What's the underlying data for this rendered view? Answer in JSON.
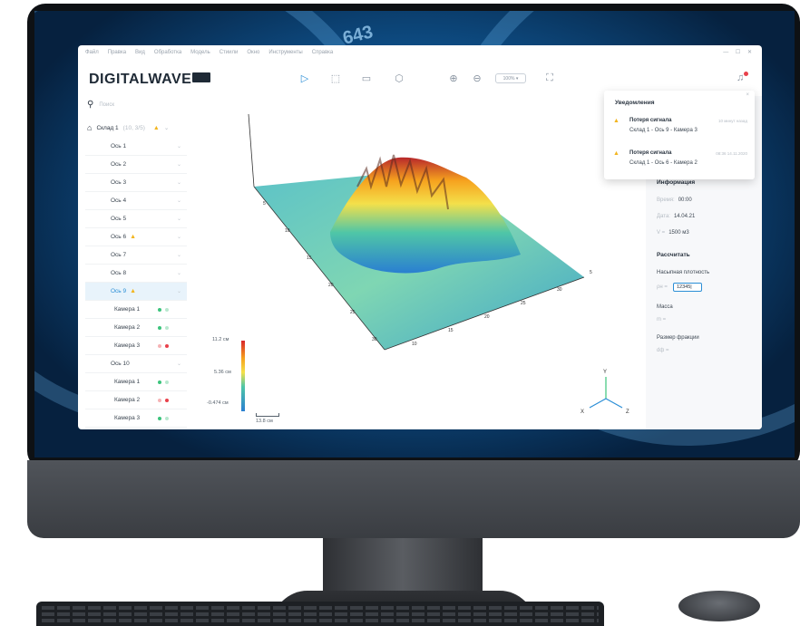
{
  "app": {
    "logo": "DIGITALWAVE",
    "menu": [
      "Файл",
      "Правка",
      "Вид",
      "Обработка",
      "Модель",
      "Стиили",
      "Окно",
      "Инструменты",
      "Справка"
    ],
    "window_controls": "— ☐ ✕",
    "zoom_value": "100% ▾"
  },
  "wall": {
    "number": "643"
  },
  "sidebar": {
    "search_placeholder": "Поиск",
    "root_label": "Склад 1",
    "root_meta": "(10, 3/5)",
    "items": [
      {
        "label": "Ось 1",
        "kind": "axis"
      },
      {
        "label": "Ось 2",
        "kind": "axis"
      },
      {
        "label": "Ось 3",
        "kind": "axis"
      },
      {
        "label": "Ось 4",
        "kind": "axis"
      },
      {
        "label": "Ось 5",
        "kind": "axis"
      },
      {
        "label": "Ось 6",
        "kind": "axis",
        "warning": true
      },
      {
        "label": "Ось 7",
        "kind": "axis"
      },
      {
        "label": "Ось 8",
        "kind": "axis"
      },
      {
        "label": "Ось 9",
        "kind": "axis",
        "warning": true,
        "active": true
      },
      {
        "label": "Камера 1",
        "kind": "cam",
        "leds": [
          "#3cc47c",
          "#b9e8cf"
        ]
      },
      {
        "label": "Камера 2",
        "kind": "cam",
        "leds": [
          "#3cc47c",
          "#b9e8cf"
        ]
      },
      {
        "label": "Камера 3",
        "kind": "cam",
        "leds": [
          "#f5b3b5",
          "#e8414b"
        ]
      },
      {
        "label": "Ось 10",
        "kind": "axis"
      },
      {
        "label": "Камера 1",
        "kind": "cam",
        "leds": [
          "#3cc47c",
          "#b9e8cf"
        ]
      },
      {
        "label": "Камера 2",
        "kind": "cam",
        "leds": [
          "#f5b3b5",
          "#e8414b"
        ]
      },
      {
        "label": "Камера 3",
        "kind": "cam",
        "leds": [
          "#3cc47c",
          "#b9e8cf"
        ]
      }
    ]
  },
  "viewport": {
    "scale_max": "11.2 см",
    "scale_mid": "5.36 см",
    "scale_min": "-0.474 см",
    "scale_ref": "13.8 см",
    "axis_x_label": "X",
    "axis_y_label": "Y",
    "axis_z_label": "Z",
    "ticks_left": [
      "5",
      "10",
      "15",
      "20",
      "25",
      "30"
    ],
    "ticks_right": [
      "10",
      "15",
      "20",
      "25",
      "30",
      "5"
    ]
  },
  "notifications": {
    "title": "Уведомления",
    "close": "×",
    "items": [
      {
        "head": "Потеря сигнала",
        "time": "10 минут назад",
        "text": "Склад 1 - Ось 9 - Камера 3"
      },
      {
        "head": "Потеря сигнала",
        "time": "08:36 14.11.2020",
        "text": "Склад 1 - Ось 6 - Камера 2"
      }
    ]
  },
  "info": {
    "title": "Информация",
    "time_label": "Время:",
    "time_value": "00:00",
    "date_label": "Дата:",
    "date_value": "14.04.21",
    "v_label": "V =",
    "v_value": "1500 м3",
    "calc_title": "Рассчитать",
    "density_label": "Насыпная плотность",
    "density_sym": "ρн =",
    "density_value": "12345|",
    "mass_label": "Масса",
    "mass_sym": "m =",
    "fraction_label": "Размер фракции",
    "fraction_sym": "dф ="
  },
  "colors": {
    "accent": "#2b8ed6",
    "warning": "#f2b51f",
    "danger": "#e8414b",
    "ok": "#3cc47c"
  }
}
